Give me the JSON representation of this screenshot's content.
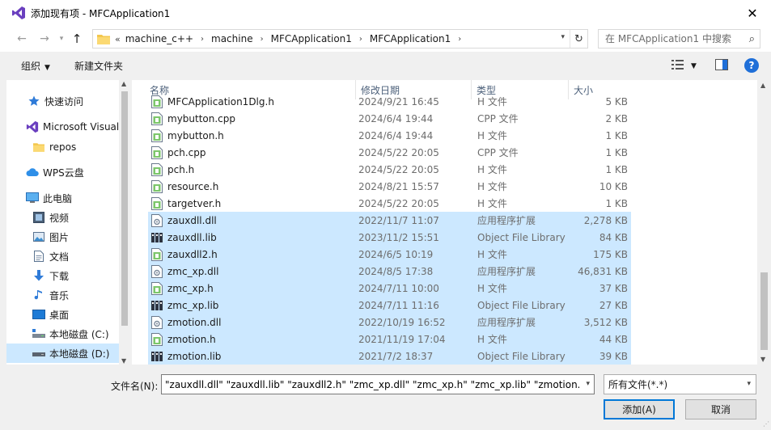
{
  "window": {
    "title": "添加现有项 - MFCApplication1"
  },
  "address": {
    "crumbs": [
      "machine_c++",
      "machine",
      "MFCApplication1",
      "MFCApplication1"
    ],
    "lead": "«",
    "search_placeholder": "在 MFCApplication1 中搜索"
  },
  "toolbar": {
    "organize_label": "组织",
    "new_folder_label": "新建文件夹"
  },
  "nav": {
    "items": [
      {
        "label": "快速访问",
        "icon": "star-icon"
      },
      {
        "label": "Microsoft Visual",
        "icon": "visual-studio-icon"
      },
      {
        "label": "repos",
        "icon": "folder-icon"
      },
      {
        "label": "WPS云盘",
        "icon": "cloud-icon"
      },
      {
        "label": "此电脑",
        "icon": "computer-icon"
      },
      {
        "label": "视频",
        "icon": "video-icon"
      },
      {
        "label": "图片",
        "icon": "pictures-icon"
      },
      {
        "label": "文档",
        "icon": "documents-icon"
      },
      {
        "label": "下载",
        "icon": "download-icon"
      },
      {
        "label": "音乐",
        "icon": "music-icon"
      },
      {
        "label": "桌面",
        "icon": "desktop-icon"
      },
      {
        "label": "本地磁盘 (C:)",
        "icon": "drive-icon"
      },
      {
        "label": "本地磁盘 (D:)",
        "icon": "drive-icon"
      }
    ]
  },
  "columns": {
    "name": "名称",
    "date": "修改日期",
    "type": "类型",
    "size": "大小"
  },
  "files": [
    {
      "name": "MFCApplication1Dlg.h",
      "date": "2024/9/21 16:45",
      "type": "H 文件",
      "size": "5 KB",
      "kind": "h",
      "selected": false
    },
    {
      "name": "mybutton.cpp",
      "date": "2024/6/4 19:44",
      "type": "CPP 文件",
      "size": "2 KB",
      "kind": "cpp",
      "selected": false
    },
    {
      "name": "mybutton.h",
      "date": "2024/6/4 19:44",
      "type": "H 文件",
      "size": "1 KB",
      "kind": "h",
      "selected": false
    },
    {
      "name": "pch.cpp",
      "date": "2024/5/22 20:05",
      "type": "CPP 文件",
      "size": "1 KB",
      "kind": "cpp",
      "selected": false
    },
    {
      "name": "pch.h",
      "date": "2024/5/22 20:05",
      "type": "H 文件",
      "size": "1 KB",
      "kind": "h",
      "selected": false
    },
    {
      "name": "resource.h",
      "date": "2024/8/21 15:57",
      "type": "H 文件",
      "size": "10 KB",
      "kind": "h",
      "selected": false
    },
    {
      "name": "targetver.h",
      "date": "2024/5/22 20:05",
      "type": "H 文件",
      "size": "1 KB",
      "kind": "h",
      "selected": false
    },
    {
      "name": "zauxdll.dll",
      "date": "2022/11/7 11:07",
      "type": "应用程序扩展",
      "size": "2,278 KB",
      "kind": "dll",
      "selected": true
    },
    {
      "name": "zauxdll.lib",
      "date": "2023/11/2 15:51",
      "type": "Object File Library",
      "size": "84 KB",
      "kind": "lib",
      "selected": true
    },
    {
      "name": "zauxdll2.h",
      "date": "2024/6/5 10:19",
      "type": "H 文件",
      "size": "175 KB",
      "kind": "h",
      "selected": true
    },
    {
      "name": "zmc_xp.dll",
      "date": "2024/8/5 17:38",
      "type": "应用程序扩展",
      "size": "46,831 KB",
      "kind": "dll",
      "selected": true
    },
    {
      "name": "zmc_xp.h",
      "date": "2024/7/11 10:00",
      "type": "H 文件",
      "size": "37 KB",
      "kind": "h",
      "selected": true
    },
    {
      "name": "zmc_xp.lib",
      "date": "2024/7/11 11:16",
      "type": "Object File Library",
      "size": "27 KB",
      "kind": "lib",
      "selected": true
    },
    {
      "name": "zmotion.dll",
      "date": "2022/10/19 16:52",
      "type": "应用程序扩展",
      "size": "3,512 KB",
      "kind": "dll",
      "selected": true
    },
    {
      "name": "zmotion.h",
      "date": "2021/11/19 17:04",
      "type": "H 文件",
      "size": "44 KB",
      "kind": "h",
      "selected": true
    },
    {
      "name": "zmotion.lib",
      "date": "2021/7/2 18:37",
      "type": "Object File Library",
      "size": "39 KB",
      "kind": "lib",
      "selected": true
    }
  ],
  "bottom": {
    "filename_label": "文件名(N):",
    "filename_value": "\"zauxdll.dll\" \"zauxdll.lib\" \"zauxdll2.h\" \"zmc_xp.dll\" \"zmc_xp.h\" \"zmc_xp.lib\" \"zmotion.dll\" \"z",
    "filter_value": "所有文件(*.*)",
    "add_label": "添加(A)",
    "cancel_label": "取消"
  },
  "colors": {
    "selection": "#cce8ff",
    "accent": "#0078d7",
    "vs_purple": "#6a3fbf"
  }
}
